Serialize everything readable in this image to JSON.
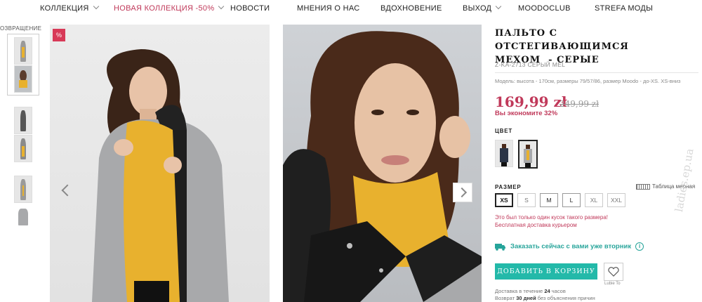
{
  "nav": {
    "items": [
      {
        "label": "КОЛЛЕКЦИЯ",
        "dropdown": true
      },
      {
        "label": "НОВАЯ КОЛЛЕКЦИЯ -50%",
        "dropdown": true,
        "highlight": true
      },
      {
        "label": "НОВОСТИ",
        "dropdown": false
      },
      {
        "label": "МНЕНИЯ О НАС",
        "dropdown": false
      },
      {
        "label": "ВДОХНОВЕНИЕ",
        "dropdown": false
      },
      {
        "label": "ВЫХОД",
        "dropdown": true
      },
      {
        "label": "MOODOCLUB",
        "dropdown": false
      },
      {
        "label": "STREFA МОДЫ",
        "dropdown": false
      }
    ]
  },
  "gallery": {
    "back_label": "ОЗВРАЩЕНИЕ",
    "badge": "%",
    "thumb_count": 6
  },
  "product": {
    "title_line1": "ПАЛЬТО С ОТСТЕГИВАЮЩИМСЯ",
    "title_line2": "МЕХОМ  - СЕРЫЕ",
    "sku": "Z-KA-2713 СЕРЫЙ MEL",
    "model_info": "Модель: высота - 170см, размеры 79/57/86, размер Moodo - до-XS. XS-вниз",
    "price": "169,99 zł",
    "old_price": "249,99 zł",
    "saving": "Вы экономите 32%",
    "color_label": "ЦВЕТ",
    "size_label": "РАЗМЕР",
    "size_table": "Таблица мерная",
    "sizes": [
      "XS",
      "S",
      "M",
      "L",
      "XL",
      "XXL"
    ],
    "selected_size": "XS",
    "warning_line1": "Это был только один кусок такого размера!",
    "warning_line2": "Бесплатная доставка курьером",
    "delivery_text": "Заказать сейчас с вами уже вторник",
    "add_to_cart": "ДОБАВИТЬ В КОРЗИНУ",
    "wishlist_label": "Lubie To",
    "footer_line1_a": "Доставка в течение ",
    "footer_line1_b": "24",
    "footer_line1_c": " часов",
    "footer_line2_a": "Возврат ",
    "footer_line2_b": "30 дней",
    "footer_line2_c": " без объяснения причин"
  },
  "colors": {
    "accent": "#c0395a",
    "teal": "#23b9a9",
    "mustard": "#e8b12e",
    "coat_grey": "#a8a9ab"
  },
  "watermark": "ladies.ep.ua"
}
